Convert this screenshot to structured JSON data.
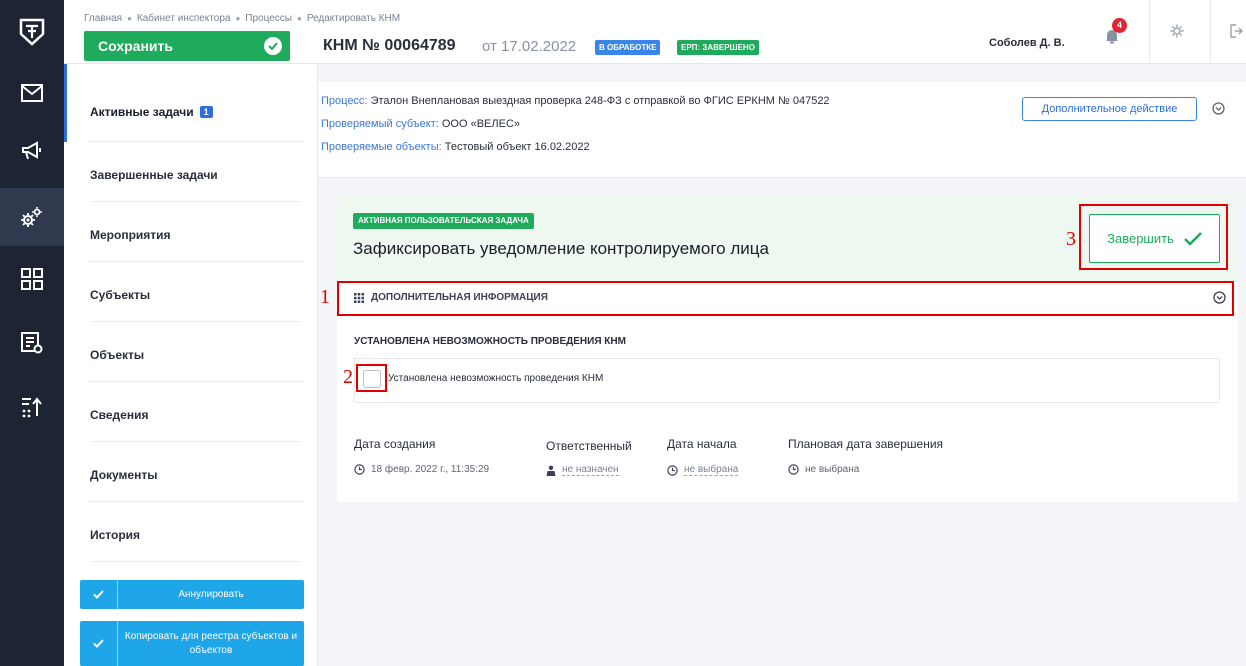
{
  "breadcrumb": [
    "Главная",
    "Кабинет инспектора",
    "Процессы",
    "Редактировать КНМ"
  ],
  "header": {
    "save_label": "Сохранить",
    "kmn_title": "КНМ № 00064789",
    "kmn_date": "от 17.02.2022",
    "status_badge": "В ОБРАБОТКЕ",
    "erp_badge": "ЕРП: ЗАВЕРШЕНО",
    "user_name": "Соболев Д. В.",
    "notification_count": "4",
    "icons": [
      "bell-icon",
      "gear-icon",
      "logout-icon"
    ]
  },
  "rail": {
    "icons": [
      "logo-icon",
      "mail-icon",
      "megaphone-icon",
      "gears-icon",
      "dashboard-icon",
      "registry-icon",
      "sort-icon"
    ],
    "active_index": 3
  },
  "nav": {
    "items": [
      {
        "label": "Активные задачи",
        "count": "1"
      },
      {
        "label": "Завершенные задачи"
      },
      {
        "label": "Мероприятия"
      },
      {
        "label": "Субъекты"
      },
      {
        "label": "Объекты"
      },
      {
        "label": "Сведения"
      },
      {
        "label": "Документы"
      },
      {
        "label": "История"
      }
    ],
    "annul_label": "Аннулировать",
    "copy_label": "Копировать для реестра субъектов и объектов"
  },
  "process": {
    "process_key": "Процесс:",
    "process_val": "Эталон Внеплановая выездная проверка 248-ФЗ с отправкой во ФГИС ЕРКНМ № 047522",
    "subject_key": "Проверяемый субъект:",
    "subject_val": "ООО «ВЕЛЕС»",
    "objects_key": "Проверяемые объекты:",
    "objects_val": "Тестовый объект 16.02.2022",
    "extra_action_label": "Дополнительное действие"
  },
  "task": {
    "badge": "АКТИВНАЯ ПОЛЬЗОВАТЕЛЬСКАЯ ЗАДАЧА",
    "title": "Зафиксировать уведомление контролируемого лица",
    "finish_label": "Завершить",
    "additional_info_label": "ДОПОЛНИТЕЛЬНАЯ ИНФОРМАЦИЯ",
    "section_title": "УСТАНОВЛЕНА НЕВОЗМОЖНОСТЬ ПРОВЕДЕНИЯ КНМ",
    "checkbox_label": "Установлена невозможность проведения КНМ",
    "checkbox_checked": false,
    "created_label": "Дата создания",
    "created_value": "18 февр. 2022 г., 11:35:29",
    "responsible_label": "Ответственный",
    "responsible_value": "не назначен",
    "start_label": "Дата начала",
    "start_value": "не выбрана",
    "planned_end_label": "Плановая дата завершения",
    "planned_end_value": "не выбрана"
  },
  "annotations": [
    "1",
    "2",
    "3"
  ],
  "colors": {
    "rail_bg": "#1d2534",
    "accent_green": "#1eab5c",
    "accent_blue": "#2c6fd8",
    "light_blue_button": "#1fa6e8",
    "annotation_red": "#e00000",
    "notification_red": "#e02430"
  }
}
